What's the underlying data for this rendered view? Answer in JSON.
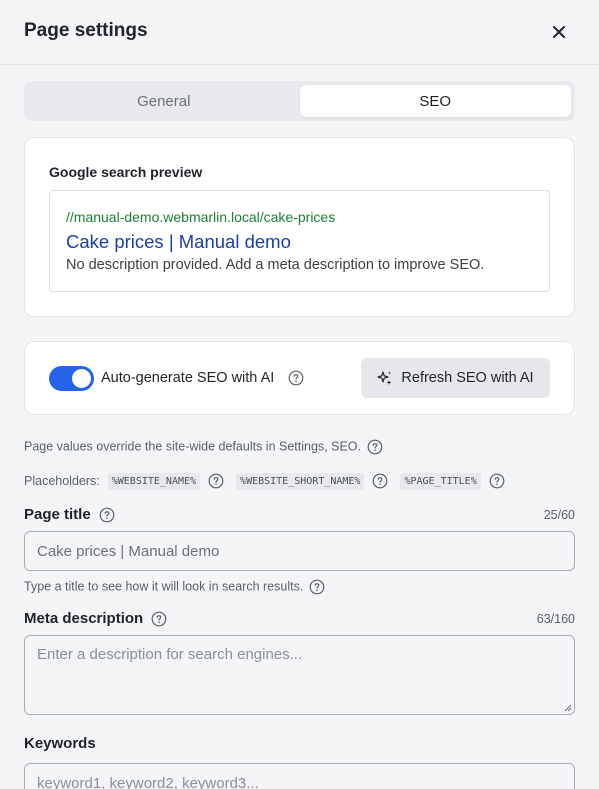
{
  "header": {
    "title": "Page settings",
    "close_icon": "close-icon"
  },
  "tabs": [
    {
      "label": "General",
      "active": false
    },
    {
      "label": "SEO",
      "active": true
    }
  ],
  "preview": {
    "label": "Google search preview",
    "url": "//manual-demo.webmarlin.local/cake-prices",
    "title": "Cake prices | Manual demo",
    "description": "No description provided. Add a meta description to improve SEO."
  },
  "ai": {
    "toggle_on": true,
    "label": "Auto-generate SEO with AI",
    "refresh_label": "Refresh SEO with AI",
    "refresh_icon": "sparkles-icon"
  },
  "notes": {
    "override": "Page values override the site-wide defaults in Settings, SEO.",
    "placeholders_label": "Placeholders:",
    "placeholders": [
      "%WEBSITE_NAME%",
      "%WEBSITE_SHORT_NAME%",
      "%PAGE_TITLE%"
    ]
  },
  "page_title": {
    "label": "Page title",
    "counter": "25/60",
    "value": "Cake prices | Manual demo",
    "hint": "Type a title to see how it will look in search results."
  },
  "meta_description": {
    "label": "Meta description",
    "counter": "63/160",
    "placeholder": "Enter a description for search engines..."
  },
  "keywords": {
    "label": "Keywords",
    "placeholder": "keyword1, keyword2, keyword3..."
  },
  "colors": {
    "accent": "#2563eb",
    "url_green": "#1a7f37",
    "link_blue": "#1a3fa8"
  }
}
